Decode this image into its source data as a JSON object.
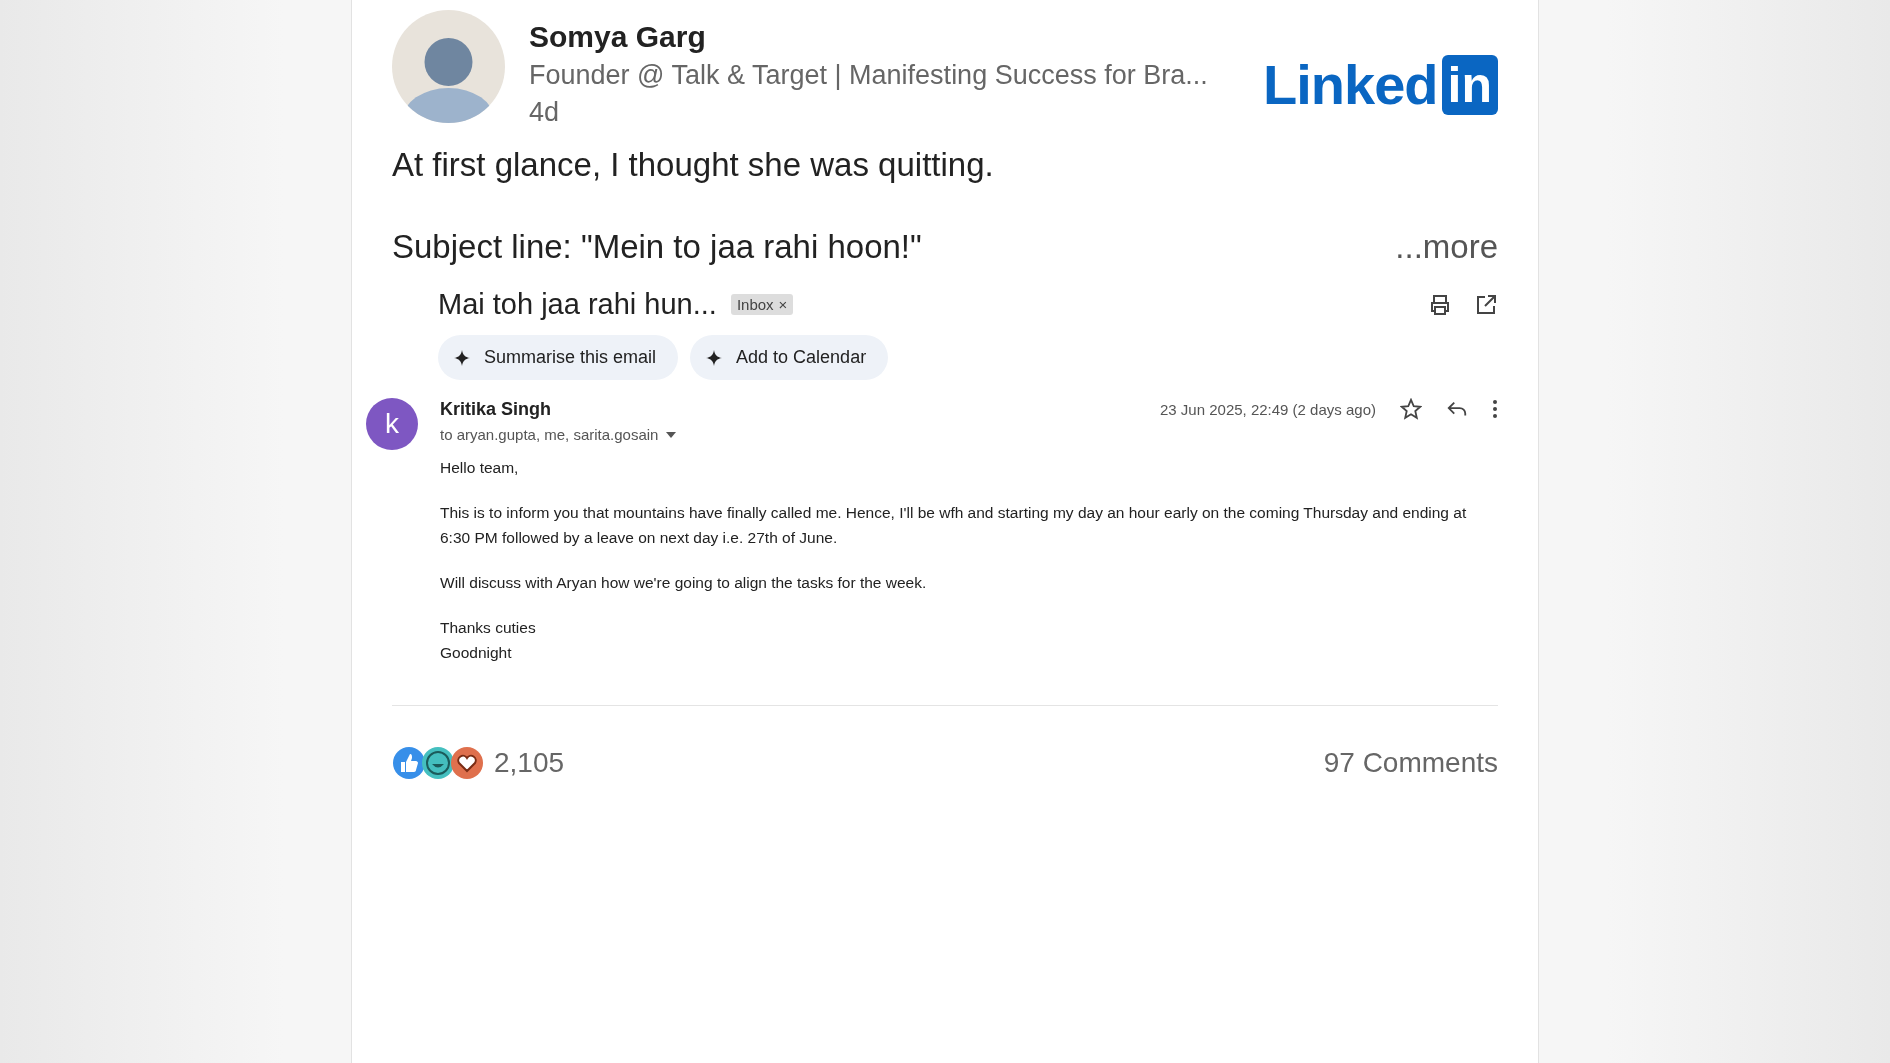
{
  "post": {
    "author": "Somya Garg",
    "headline": "Founder @ Talk & Target | Manifesting Success for Bra...",
    "age": "4d",
    "logo": {
      "word": "Linked",
      "badge": "in"
    },
    "text": [
      "At first glance, I thought she was quitting.",
      "Subject line: \"Mein to jaa rahi hoon!\""
    ],
    "more": "...more",
    "email": {
      "subject": "Mai toh jaa rahi hun...",
      "label": "Inbox",
      "label_close": "×",
      "actions": [
        "Summarise this email",
        "Add to Calendar"
      ],
      "sender": {
        "initial": "k",
        "name": "Kritika Singh",
        "recipients": "to aryan.gupta, me, sarita.gosain",
        "date": "23 Jun 2025, 22:49 (2 days ago)"
      },
      "body": [
        "Hello team,",
        "This is to inform you that mountains have finally called me. Hence, I'll be wfh and starting my day an hour early on the coming Thursday and ending at 6:30 PM followed by a leave on next day i.e. 27th of June.",
        "Will discuss with Aryan how we're going to align the tasks for the week.",
        "Thanks cuties\nGoodnight"
      ]
    },
    "reactions": {
      "count": "2,105",
      "comments": "97 Comments"
    }
  }
}
